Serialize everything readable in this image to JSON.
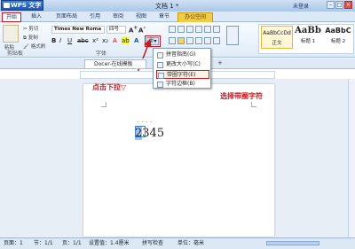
{
  "app": {
    "name": "WPS 文字",
    "doc_title": "文档 1 *"
  },
  "tabs": [
    {
      "label": "开始",
      "active": true
    },
    {
      "label": "插入"
    },
    {
      "label": "页面布局"
    },
    {
      "label": "引用"
    },
    {
      "label": "审阅"
    },
    {
      "label": "视图"
    },
    {
      "label": "章节"
    },
    {
      "label": "办公空间",
      "special": true
    }
  ],
  "titlebar": {
    "login": "未登录"
  },
  "ribbon": {
    "paste": "粘贴",
    "cut": "剪切",
    "copy": "复制",
    "format_painter": "格式刷",
    "font_name": "Times New Roma",
    "font_size": "四号",
    "groups": {
      "clipboard": "剪贴板",
      "font": "字体"
    },
    "styles": [
      {
        "preview": "AaBbCcDd",
        "name": "正文"
      },
      {
        "preview": "AaBb",
        "name": "标题 1"
      },
      {
        "preview": "AaBbC",
        "name": "标题 2"
      }
    ]
  },
  "doctabs": {
    "tab1": "Docer-在线模板",
    "tab2": "文档 1 *"
  },
  "dropdown": {
    "items": [
      {
        "label": "拼音指南(G)"
      },
      {
        "label": "更改大小写(C)"
      },
      {
        "label": "带圈字符(E)",
        "highlighted": true
      },
      {
        "label": "字符边框(B)"
      }
    ]
  },
  "annotations": {
    "click_dropdown": "点击下拉▽",
    "select_char": "选择带圈字符"
  },
  "document": {
    "text": "2345",
    "marks": "ˇˇˇˇ"
  },
  "status": {
    "page": "页面：1",
    "section": "节：1/1",
    "pages": "页：1/1",
    "col": "设置值：1.4厘米",
    "spell": "拼写检查",
    "unit": "单位：毫米"
  },
  "colors": {
    "accent": "#d0161c",
    "ribbon": "#e1ecf8",
    "brand": "#1d56b0"
  }
}
